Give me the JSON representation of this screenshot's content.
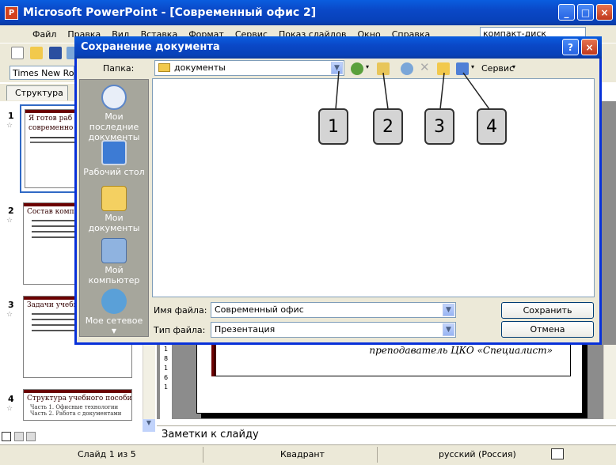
{
  "app": {
    "title": "Microsoft PowerPoint - [Современный офис 2]",
    "window_buttons": [
      "_",
      "□",
      "×"
    ]
  },
  "menu": [
    "Файл",
    "Правка",
    "Вид",
    "Вставка",
    "Формат",
    "Сервис",
    "Показ слайдов",
    "Окно",
    "Справка"
  ],
  "help_box": {
    "value": "компакт-диск"
  },
  "font_box": {
    "value": "Times New Rom"
  },
  "outline_tab": "Структура",
  "slides": [
    {
      "num": "1",
      "title": "Я готов раб",
      "subtitle": "современно"
    },
    {
      "num": "2",
      "title": "Состав комплекта"
    },
    {
      "num": "3",
      "title": "Задачи учебного"
    },
    {
      "num": "4",
      "title": "Структура учебного пособия",
      "lines": [
        "Часть 1. Офисные технологии",
        "Часть 2. Работа с документами"
      ]
    }
  ],
  "slide_text": {
    "line": "преподаватель ЦКО «Специалист»"
  },
  "ruler_labels": [
    "1",
    "8",
    "1",
    "6",
    "1"
  ],
  "notes_placeholder": "Заметки к слайду",
  "status": {
    "slide": "Слайд 1 из 5",
    "design": "Квадрант",
    "language": "русский (Россия)"
  },
  "dialog": {
    "title": "Сохранение документа",
    "help_btn": "?",
    "close_btn": "×",
    "folder_label": "Папка:",
    "folder_value": "документы",
    "service_label": "Сервис",
    "places": [
      {
        "label": "Мои последние документы",
        "icon": "recent-docs-icon"
      },
      {
        "label": "Рабочий стол",
        "icon": "desktop-icon"
      },
      {
        "label": "Мои документы",
        "icon": "my-documents-icon"
      },
      {
        "label": "Мой компьютер",
        "icon": "my-computer-icon"
      },
      {
        "label": "Мое сетевое",
        "icon": "network-icon"
      }
    ],
    "filename_label": "Имя файла:",
    "filename_value": "Современный офис",
    "filetype_label": "Тип файла:",
    "filetype_value": "Презентация",
    "save_btn": "Сохранить",
    "cancel_btn": "Отмена"
  },
  "callouts": [
    "1",
    "2",
    "3",
    "4"
  ],
  "colors": {
    "title_blue": "#0a48c7",
    "dialog_bg": "#ece9d8",
    "places_bg": "#a6a69c",
    "slide_accent": "#6b0000"
  }
}
